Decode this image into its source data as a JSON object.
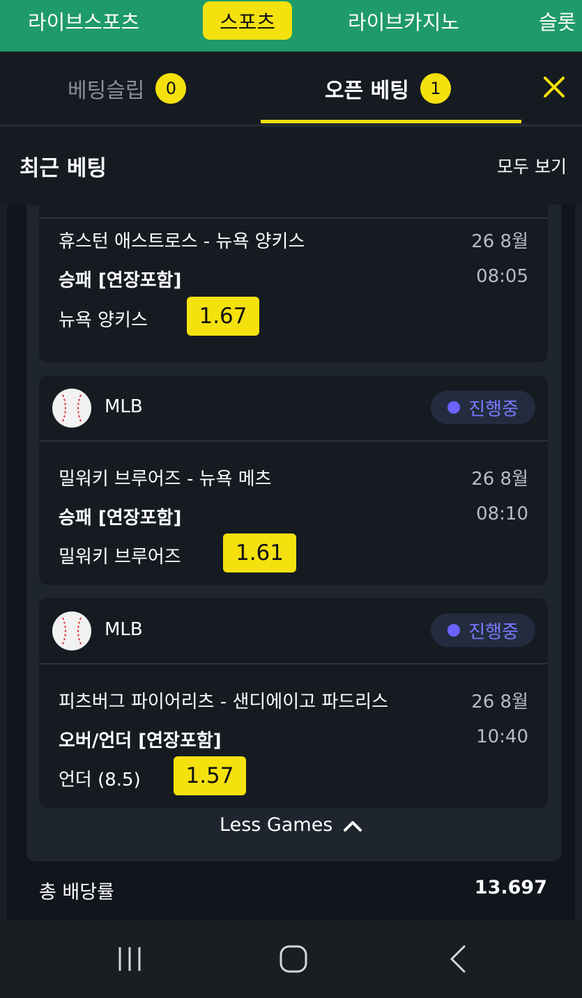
{
  "topnav": {
    "items": [
      {
        "label": "라이브스포츠",
        "active": false
      },
      {
        "label": "스포츠",
        "active": true
      },
      {
        "label": "라이브카지노",
        "active": false
      },
      {
        "label": "슬롯",
        "active": false
      }
    ]
  },
  "tabs": {
    "betslip": {
      "label": "베팅슬립",
      "count": "0"
    },
    "open_bets": {
      "label": "오픈 베팅",
      "count": "1"
    }
  },
  "recent": {
    "title": "최근 베팅",
    "view_all": "모두 보기"
  },
  "bets": [
    {
      "league": "",
      "status": "",
      "match": "휴스턴 애스트로스 - 뉴욕 양키스",
      "date": "26 8월",
      "market": "승패 [연장포함]",
      "time": "08:05",
      "pick": "뉴욕 양키스",
      "odds": "1.67"
    },
    {
      "league": "MLB",
      "status": "진행중",
      "match": "밀워키 브루어즈 - 뉴욕 메츠",
      "date": "26 8월",
      "market": "승패 [연장포함]",
      "time": "08:10",
      "pick": "밀워키 브루어즈",
      "odds": "1.61"
    },
    {
      "league": "MLB",
      "status": "진행중",
      "match": "피츠버그 파이어리츠 - 샌디에이고 파드리스",
      "date": "26 8월",
      "market": "오버/언더 [연장포함]",
      "time": "10:40",
      "pick": "언더 (8.5)",
      "odds": "1.57"
    }
  ],
  "less_games": "Less Games",
  "total": {
    "label": "총 배당률",
    "value": "13.697"
  },
  "colors": {
    "accent": "#f4e10e",
    "nav_green": "#1f9a6a",
    "status_purple": "#6c63ff"
  },
  "icons": {
    "close": "close-icon",
    "league": "baseball-icon",
    "less": "chevron-up-icon",
    "sys_recent": "recent-apps-icon",
    "sys_home": "home-icon",
    "sys_back": "back-icon"
  }
}
